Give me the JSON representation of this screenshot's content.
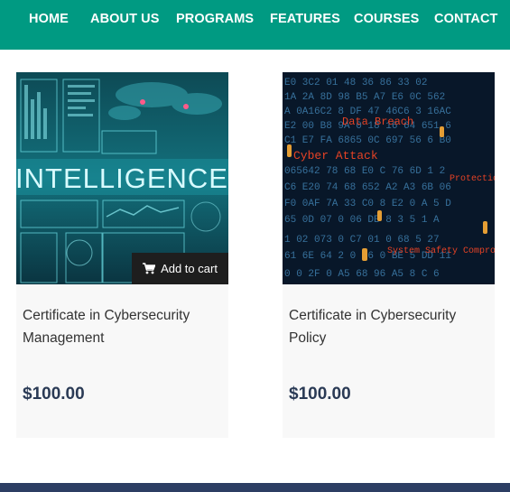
{
  "nav": {
    "items": [
      "HOME",
      "ABOUT US",
      "PROGRAMS",
      "FEATURES",
      "COURSES",
      "CONTACT"
    ]
  },
  "products": [
    {
      "image_word": "INTELLIGENCE",
      "add_to_cart_label": "Add to cart",
      "title": "Certificate in Cybersecurity Management",
      "price": "$100.00"
    },
    {
      "image_words": [
        "Data Breach",
        "Cyber Attack",
        "Protection",
        "System Safety Compromised"
      ],
      "title": "Certificate in Cybersecurity Policy",
      "price": "$100.00"
    }
  ],
  "colors": {
    "nav_bg": "#009a82",
    "footer_bg": "#2c3e63",
    "price_text": "#2a3a55",
    "card_bg": "#f8f8f8"
  }
}
